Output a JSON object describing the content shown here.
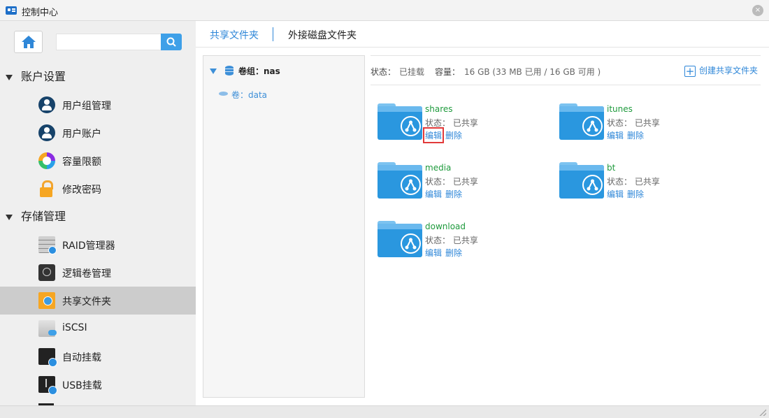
{
  "window": {
    "title": "控制中心",
    "close": "×"
  },
  "sidebar": {
    "search": {
      "placeholder": "",
      "value": ""
    },
    "sections": [
      {
        "label": "账户设置"
      },
      {
        "label": "存储管理"
      }
    ],
    "items": [
      {
        "label": "用户组管理",
        "icon": "user-group-icon"
      },
      {
        "label": "用户账户",
        "icon": "user-account-icon"
      },
      {
        "label": "容量限额",
        "icon": "quota-icon"
      },
      {
        "label": "修改密码",
        "icon": "lock-icon"
      },
      {
        "label": "RAID管理器",
        "icon": "raid-icon"
      },
      {
        "label": "逻辑卷管理",
        "icon": "lvm-icon"
      },
      {
        "label": "共享文件夹",
        "icon": "shared-folder-icon",
        "active": true
      },
      {
        "label": "iSCSI",
        "icon": "iscsi-icon"
      },
      {
        "label": "自动挂载",
        "icon": "auto-mount-icon"
      },
      {
        "label": "USB挂载",
        "icon": "usb-icon"
      }
    ]
  },
  "main": {
    "tabs": [
      {
        "label": "共享文件夹",
        "active": true
      },
      {
        "label": "外接磁盘文件夹",
        "active": false
      }
    ],
    "tree": {
      "group": "卷组：nas",
      "volume": "卷：data"
    },
    "info": {
      "status_label": "状态：",
      "status_value": "已挂载",
      "capacity_label": "容量：",
      "capacity_value": "16 GB (33 MB 已用 / 16 GB 可用 )",
      "create_button": "创建共享文件夹"
    },
    "folders": [
      {
        "name": "shares",
        "status": "状态：  已共享",
        "edit": "编辑",
        "delete": "删除"
      },
      {
        "name": "itunes",
        "status": "状态：  已共享",
        "edit": "编辑",
        "delete": "删除"
      },
      {
        "name": "media",
        "status": "状态：  已共享",
        "edit": "编辑",
        "delete": "删除"
      },
      {
        "name": "bt",
        "status": "状态：  已共享",
        "edit": "编辑",
        "delete": "删除"
      },
      {
        "name": "download",
        "status": "状态：  已共享",
        "edit": "编辑",
        "delete": "删除"
      }
    ]
  },
  "colors": {
    "accent": "#2f87d8",
    "folder": "#2a97df",
    "folder_name": "#1e9a3c",
    "highlight": "#e23a3a",
    "active_nav": "#cccccc"
  }
}
